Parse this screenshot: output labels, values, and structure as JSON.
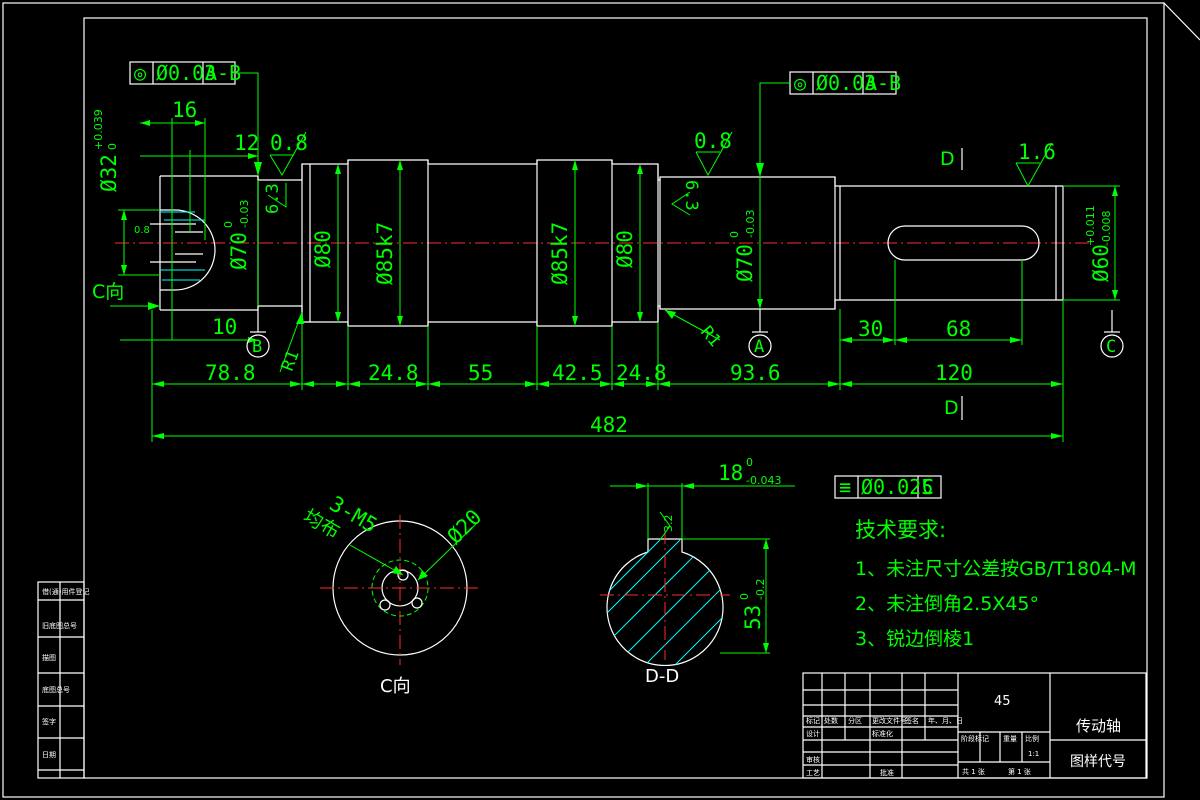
{
  "drawing": {
    "gtol_left": [
      "◎",
      "Ø0.03",
      "A-B"
    ],
    "gtol_right": [
      "◎",
      "Ø0.03",
      "A-B"
    ],
    "gtol_key": [
      "≡",
      "Ø0.025",
      "C"
    ],
    "dims": {
      "d16": "16",
      "d12": "12",
      "d10": "10",
      "d32": "Ø32",
      "d32_tol_up": "+0.039",
      "d32_tol_lo": "0",
      "d08": "0.8",
      "d70l": "Ø70",
      "d70l_tol_up": "0",
      "d70l_tol_lo": "-0.03",
      "d80a": "Ø80",
      "d85a": "Ø85k7",
      "d85b": "Ø85k7",
      "d80b": "Ø80",
      "d70r": "Ø70",
      "d70r_tol_up": "0",
      "d70r_tol_lo": "-0.03",
      "d60": "Ø60",
      "d60_tol_up": "+0.011",
      "d60_tol_lo": "-0.008",
      "r1a": "R1",
      "r1b": "R1",
      "s788": "78.8",
      "s248a": "24.8",
      "s55": "55",
      "s425": "42.5",
      "s248b": "24.8",
      "s936": "93.6",
      "s120": "120",
      "s30": "30",
      "s68": "68",
      "total": "482",
      "rough08a": "0.8",
      "rough08b": "0.8",
      "rough63a": "6.3",
      "rough63b": "6.3",
      "rough16": "1.6",
      "key_w": "18",
      "key_w_up": "0",
      "key_w_lo": "-0.043",
      "key_d": "53",
      "key_d_up": "0",
      "key_d_lo": "-0.2",
      "rough32": "3.2",
      "m5": "3-M5",
      "pcd": "Ø20",
      "even": "均布"
    },
    "datums": {
      "a": "A",
      "b": "B",
      "c": "C"
    },
    "section_mark": "D",
    "view_c_arrow": "C向",
    "view_c_label": "C向",
    "view_d_label": "D-D"
  },
  "tech_req": {
    "title": "技术要求:",
    "items": [
      "1、未注尺寸公差按GB/T1804-M",
      "2、未注倒角2.5X45°",
      "3、锐边倒棱1"
    ]
  },
  "title_block": {
    "material": "45",
    "part_name": "传动轴",
    "drawing_code": "图样代号",
    "cells": {
      "mark": "标记",
      "count": "处数",
      "zone": "分区",
      "change_doc": "更改文件号",
      "sign": "签名",
      "date": "年、月、日",
      "design": "设计",
      "standard": "标准化",
      "stage_mark": "阶段标记",
      "weight": "重量",
      "scale": "比例",
      "review": "审核",
      "process": "工艺",
      "approve": "批准",
      "sheets": "共 1 张",
      "sheet_no": "第 1 张",
      "scale_val": "1:1"
    }
  },
  "side_strip": [
    "借(通)用件登记",
    "旧底图总号",
    "描图",
    "底图总号",
    "签字",
    "日期"
  ]
}
